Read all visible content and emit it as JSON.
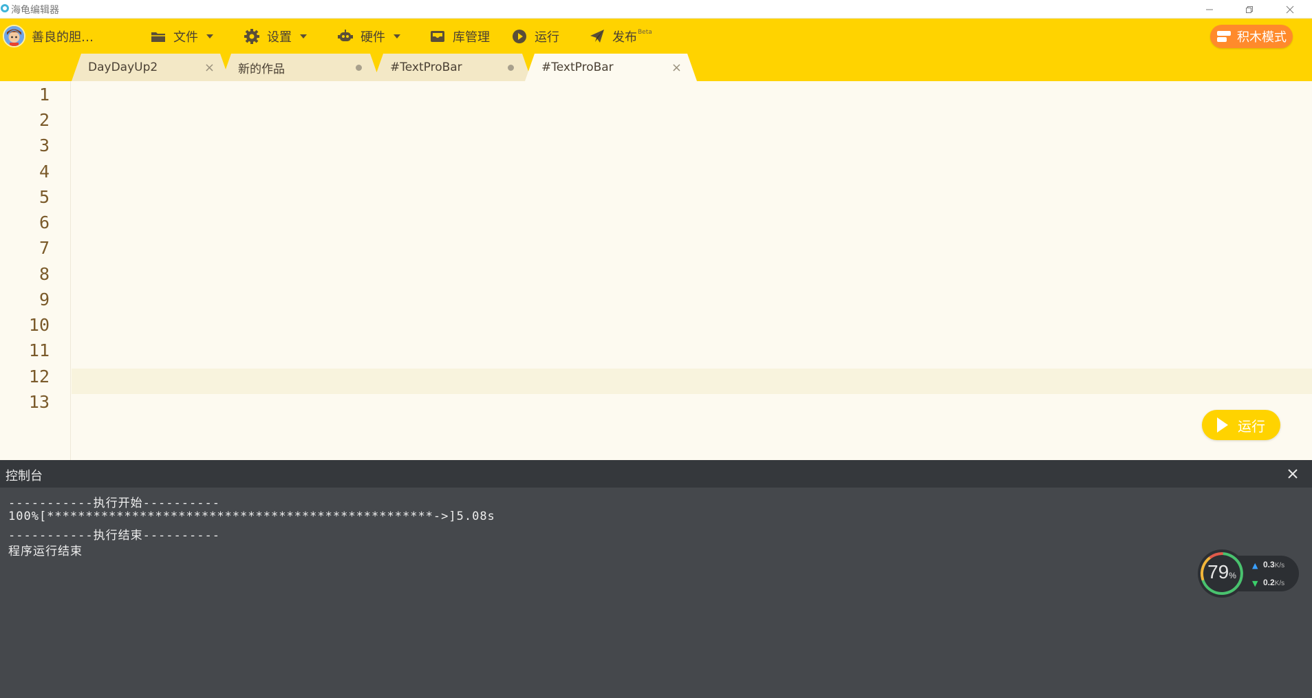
{
  "window": {
    "title": "海龟编辑器"
  },
  "menubar": {
    "user_name": "善良的胆…",
    "file": "文件",
    "settings": "设置",
    "hardware": "硬件",
    "library": "库管理",
    "run": "运行",
    "publish": "发布",
    "publish_badge": "Beta",
    "block_mode": "积木模式"
  },
  "tabs": [
    {
      "label": "DayDayUp2",
      "marker": "×"
    },
    {
      "label": "新的作品",
      "marker": "dot"
    },
    {
      "label": "#TextProBar",
      "marker": "dot"
    },
    {
      "label": "#TextProBar",
      "marker": "×",
      "active": true
    }
  ],
  "editor": {
    "line_numbers": [
      "1",
      "2",
      "3",
      "4",
      "5",
      "6",
      "7",
      "8",
      "9",
      "10",
      "11",
      "12",
      "13"
    ],
    "run_button": "运行",
    "current_line": 12
  },
  "console": {
    "title": "控制台",
    "lines": [
      "-----------执行开始----------",
      "100%[**************************************************->]5.08s",
      "-----------执行结束----------",
      "程序运行结束"
    ]
  },
  "perf_widget": {
    "percent": "79",
    "percent_unit": "%",
    "upload": "0.3",
    "download": "0.2",
    "speed_unit": "K/s"
  },
  "colors": {
    "accent": "#ffd300",
    "block_mode": "#ff8a2b",
    "keyword": "#3a88c6",
    "builtin": "#e4325a",
    "number": "#7f6ad6",
    "string": "#3a9a52"
  }
}
